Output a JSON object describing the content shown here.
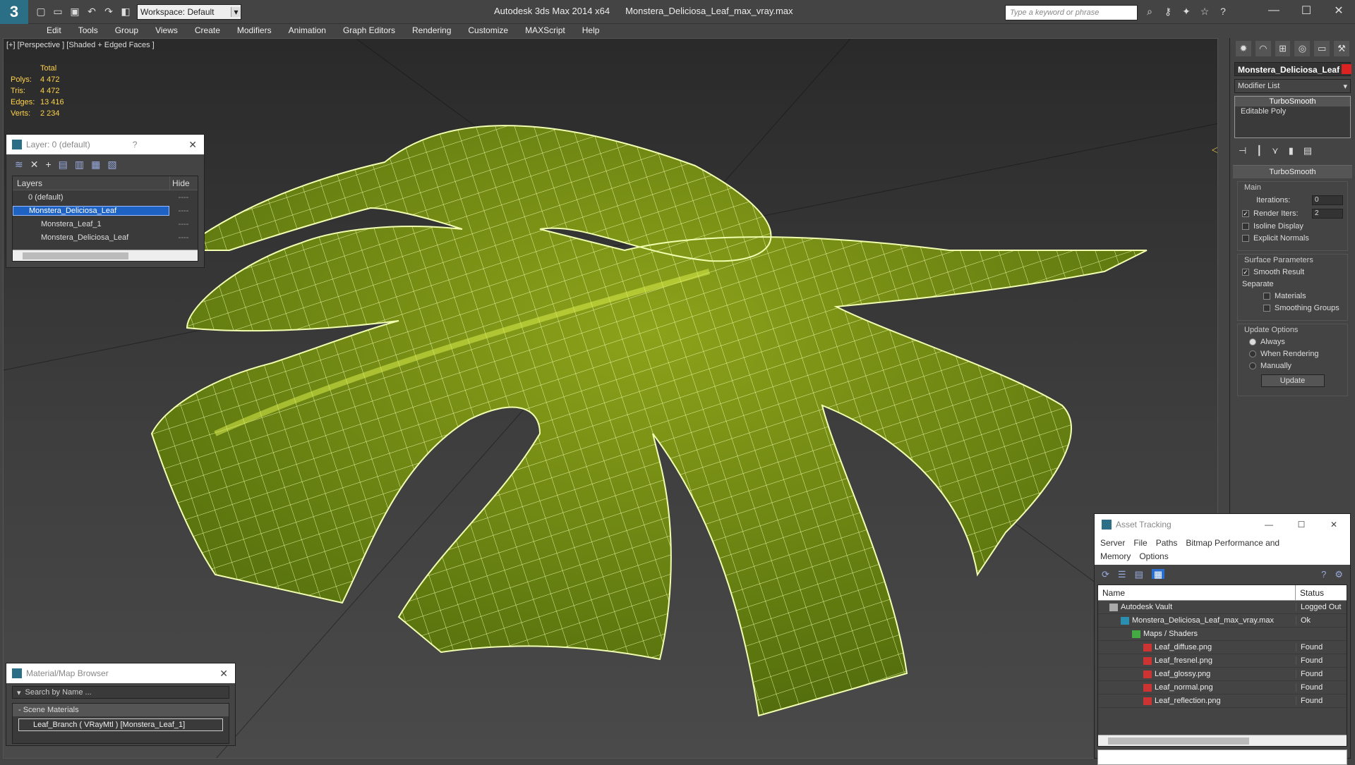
{
  "titlebar": {
    "logo": "3",
    "workspace": "Workspace: Default",
    "app": "Autodesk 3ds Max  2014 x64",
    "file": "Monstera_Deliciosa_Leaf_max_vray.max",
    "search_placeholder": "Type a keyword or phrase"
  },
  "menu": [
    "Edit",
    "Tools",
    "Group",
    "Views",
    "Create",
    "Modifiers",
    "Animation",
    "Graph Editors",
    "Rendering",
    "Customize",
    "MAXScript",
    "Help"
  ],
  "viewport": {
    "label": "[+] [Perspective ] [Shaded + Edged Faces ]",
    "stats": {
      "header": "Total",
      "rows": [
        {
          "k": "Polys:",
          "v": "4 472"
        },
        {
          "k": "Tris:",
          "v": "4 472"
        },
        {
          "k": "Edges:",
          "v": "13 416"
        },
        {
          "k": "Verts:",
          "v": "2 234"
        }
      ]
    }
  },
  "layer_panel": {
    "title": "Layer: 0 (default)",
    "help": "?",
    "col_layers": "Layers",
    "col_hide": "Hide",
    "rows": [
      {
        "name": "0 (default)",
        "hide": "----",
        "selected": false
      },
      {
        "name": "Monstera_Deliciosa_Leaf",
        "hide": "----",
        "selected": true
      },
      {
        "name": "Monstera_Leaf_1",
        "hide": "----",
        "selected": false
      },
      {
        "name": "Monstera_Deliciosa_Leaf",
        "hide": "----",
        "selected": false
      }
    ]
  },
  "material_panel": {
    "title": "Material/Map Browser",
    "search": "Search by Name ...",
    "section": "- Scene Materials",
    "item": "Leaf_Branch  ( VRayMtl ) [Monstera_Leaf_1]"
  },
  "command_panel": {
    "object_name": "Monstera_Deliciosa_Leaf",
    "modifier_list": "Modifier List",
    "stack": [
      "TurboSmooth",
      "Editable Poly"
    ],
    "rollout": "TurboSmooth",
    "main": {
      "title": "Main",
      "iterations_label": "Iterations:",
      "iterations": "0",
      "render_iters_label": "Render Iters:",
      "render_iters": "2",
      "isoline": "Isoline Display",
      "explicit": "Explicit Normals"
    },
    "surface": {
      "title": "Surface Parameters",
      "smooth": "Smooth Result",
      "separate": "Separate",
      "materials": "Materials",
      "smoothing": "Smoothing Groups"
    },
    "update": {
      "title": "Update Options",
      "always": "Always",
      "when_rendering": "When Rendering",
      "manually": "Manually",
      "button": "Update"
    }
  },
  "asset_panel": {
    "title": "Asset Tracking",
    "menu": [
      "Server",
      "File",
      "Paths",
      "Bitmap Performance and Memory",
      "Options"
    ],
    "col_name": "Name",
    "col_status": "Status",
    "rows": [
      {
        "name": "Autodesk Vault",
        "status": "Logged Out",
        "indent": 1,
        "icon": "vault-icon"
      },
      {
        "name": "Monstera_Deliciosa_Leaf_max_vray.max",
        "status": "Ok",
        "indent": 2,
        "icon": "max-file-icon"
      },
      {
        "name": "Maps / Shaders",
        "status": "",
        "indent": 3,
        "icon": "maps-icon"
      },
      {
        "name": "Leaf_diffuse.png",
        "status": "Found",
        "indent": 4,
        "icon": "png-icon"
      },
      {
        "name": "Leaf_fresnel.png",
        "status": "Found",
        "indent": 4,
        "icon": "png-icon"
      },
      {
        "name": "Leaf_glossy.png",
        "status": "Found",
        "indent": 4,
        "icon": "png-icon"
      },
      {
        "name": "Leaf_normal.png",
        "status": "Found",
        "indent": 4,
        "icon": "png-icon"
      },
      {
        "name": "Leaf_reflection.png",
        "status": "Found",
        "indent": 4,
        "icon": "png-icon"
      }
    ]
  },
  "colors": {
    "leaf": "#6b8a12",
    "wire": "#f2ffb0",
    "stats": "#ffd24a",
    "selection": "#1e63c4"
  }
}
